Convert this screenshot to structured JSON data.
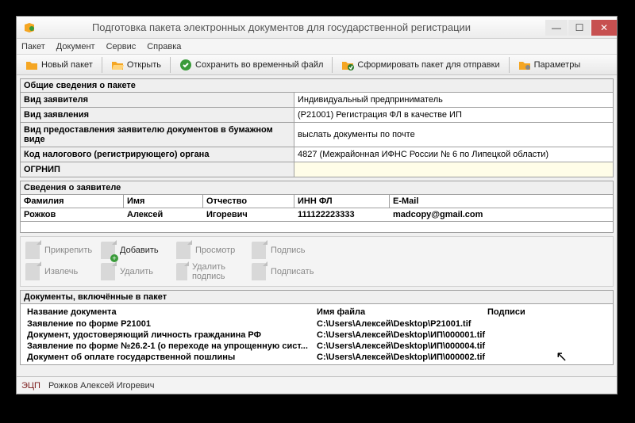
{
  "window": {
    "title": "Подготовка пакета электронных документов для государственной регистрации"
  },
  "menu": [
    "Пакет",
    "Документ",
    "Сервис",
    "Справка"
  ],
  "toolbar": {
    "new": "Новый пакет",
    "open": "Открыть",
    "save_temp": "Сохранить во временный файл",
    "form_packet": "Сформировать пакет для отправки",
    "params": "Параметры"
  },
  "sections": {
    "package_info": "Общие сведения о пакете",
    "applicant_info": "Сведения о заявителе",
    "docs_included": "Документы, включённые в пакет"
  },
  "package_fields": {
    "applicant_type_label": "Вид заявителя",
    "applicant_type_value": "Индивидуальный предприниматель",
    "application_type_label": "Вид заявления",
    "application_type_value": "(Р21001) Регистрация ФЛ в качестве ИП",
    "delivery_label": "Вид предоставления заявителю документов в бумажном виде",
    "delivery_value": "выслать документы по почте",
    "tax_code_label": "Код налогового (регистрирующего) органа",
    "tax_code_value": "4827 (Межрайонная ИФНС России № 6 по Липецкой области)",
    "ogrnip_label": "ОГРНИП",
    "ogrnip_value": ""
  },
  "applicant_headers": {
    "surname": "Фамилия",
    "name": "Имя",
    "patronymic": "Отчество",
    "inn": "ИНН ФЛ",
    "email": "E-Mail"
  },
  "applicant": {
    "surname": "Рожков",
    "name": "Алексей",
    "patronymic": "Игоревич",
    "inn": "111122223333",
    "email": "madcopy@gmail.com"
  },
  "actions": {
    "attach": "Прикрепить",
    "add": "Добавить",
    "view": "Просмотр",
    "signature": "Подпись",
    "extract": "Извлечь",
    "delete": "Удалить",
    "del_sign": "Удалить подпись",
    "sign": "Подписать"
  },
  "doc_columns": {
    "name": "Название документа",
    "file": "Имя файла",
    "sign": "Подписи"
  },
  "documents": [
    {
      "name": "Заявление по форме Р21001",
      "file": "C:\\Users\\Алексей\\Desktop\\P21001.tif"
    },
    {
      "name": "Документ, удостоверяющий личность гражданина РФ",
      "file": "C:\\Users\\Алексей\\Desktop\\ИП\\000001.tif"
    },
    {
      "name": "Заявление по форме №26.2-1 (о переходе на упрощенную сист...",
      "file": "C:\\Users\\Алексей\\Desktop\\ИП\\000004.tif"
    },
    {
      "name": "Документ об оплате государственной пошлины",
      "file": "C:\\Users\\Алексей\\Desktop\\ИП\\000002.tif"
    }
  ],
  "status": {
    "ecp": "ЭЦП",
    "user": "Рожков Алексей Игоревич"
  }
}
